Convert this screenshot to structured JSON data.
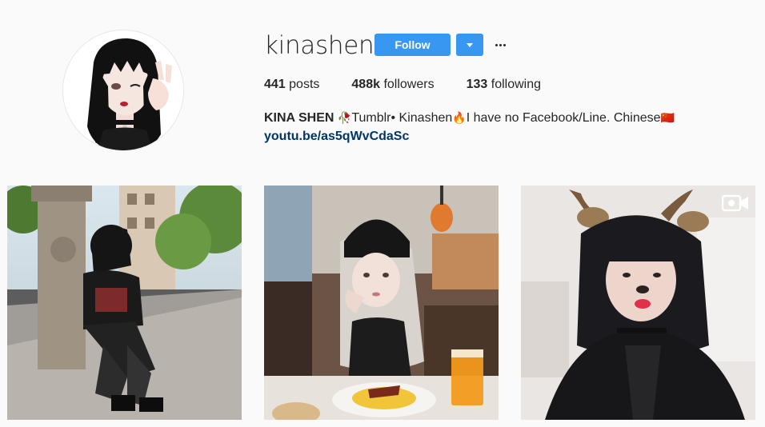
{
  "profile": {
    "username": "kinashen",
    "follow_label": "Follow",
    "stats": {
      "posts_count": "441",
      "posts_label": "posts",
      "followers_count": "488k",
      "followers_label": "followers",
      "following_count": "133",
      "following_label": "following"
    },
    "bio": {
      "name": "KINA SHEN",
      "emoji_1": "🥀",
      "text_1": "Tumblr• Kinashen",
      "emoji_2": "🔥",
      "text_2": "I have no Facebook/Line. Chinese",
      "emoji_3": "🇨🇳"
    },
    "link": "youtu.be/as5qWvCdaSc"
  },
  "posts": [
    {
      "kind": "photo"
    },
    {
      "kind": "photo"
    },
    {
      "kind": "video"
    }
  ],
  "colors": {
    "accent": "#3897f0",
    "link": "#003569",
    "background": "#fafafa",
    "text": "#262626"
  },
  "icons": {
    "dropdown": "chevron-down-icon",
    "more": "more-options-icon",
    "video": "video-camera-icon"
  }
}
